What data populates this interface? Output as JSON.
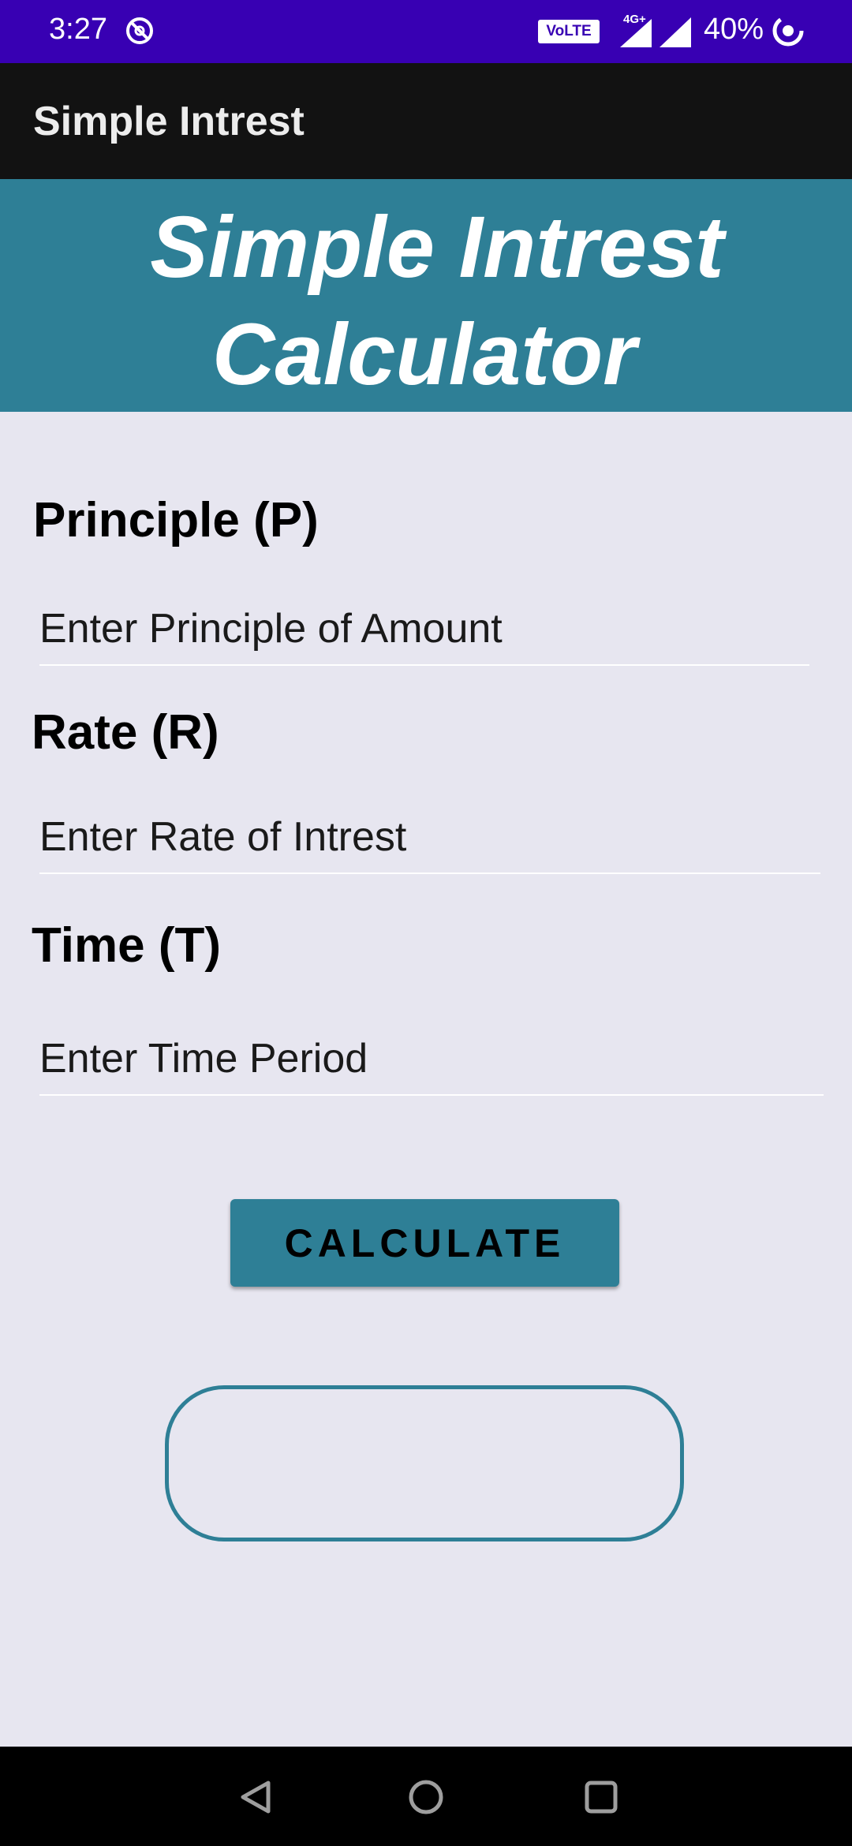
{
  "status_bar": {
    "time": "3:27",
    "volte": "VoLTE",
    "network": "4G+",
    "battery": "40%",
    "icons": [
      "sync-disabled-icon",
      "volte-icon",
      "signal-icon",
      "signal-icon",
      "battery-saver-icon"
    ],
    "background_color": "#3800b3"
  },
  "app_bar": {
    "title": "Simple Intrest",
    "background_color": "#121212"
  },
  "banner": {
    "line1": "Simple Intrest",
    "line2": "Calculator",
    "background_color": "#2e7f96"
  },
  "form": {
    "principle": {
      "label": "Principle (P)",
      "placeholder": "Enter Principle of Amount",
      "value": ""
    },
    "rate": {
      "label": "Rate (R)",
      "placeholder": "Enter Rate of Intrest",
      "value": ""
    },
    "time": {
      "label": "Time (T)",
      "placeholder": "Enter Time Period",
      "value": ""
    }
  },
  "calculate_button": {
    "label": "CALCULATE",
    "color": "#2e7f96"
  },
  "result": {
    "text": ""
  },
  "nav_bar": {
    "icons": [
      "back-icon",
      "home-icon",
      "recents-icon"
    ]
  }
}
